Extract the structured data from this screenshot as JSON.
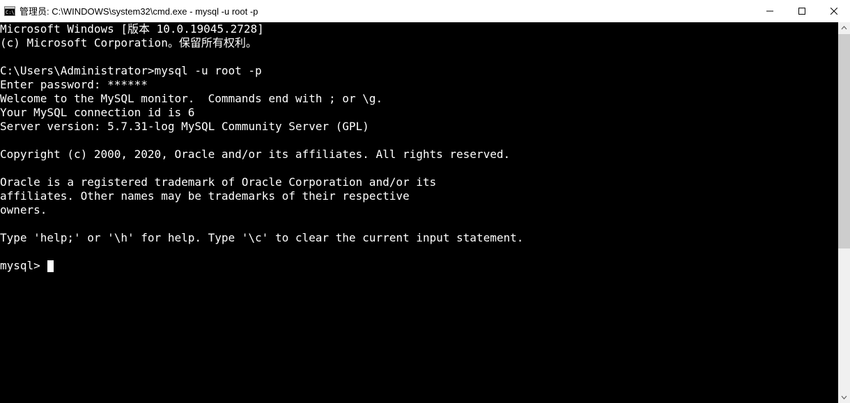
{
  "window": {
    "title": "管理员: C:\\WINDOWS\\system32\\cmd.exe - mysql  -u root -p"
  },
  "terminal": {
    "lines": [
      "Microsoft Windows [版本 10.0.19045.2728]",
      "(c) Microsoft Corporation。保留所有权利。",
      "",
      "C:\\Users\\Administrator>mysql -u root -p",
      "Enter password: ******",
      "Welcome to the MySQL monitor.  Commands end with ; or \\g.",
      "Your MySQL connection id is 6",
      "Server version: 5.7.31-log MySQL Community Server (GPL)",
      "",
      "Copyright (c) 2000, 2020, Oracle and/or its affiliates. All rights reserved.",
      "",
      "Oracle is a registered trademark of Oracle Corporation and/or its",
      "affiliates. Other names may be trademarks of their respective",
      "owners.",
      "",
      "Type 'help;' or '\\h' for help. Type '\\c' to clear the current input statement.",
      ""
    ],
    "prompt": "mysql> "
  }
}
